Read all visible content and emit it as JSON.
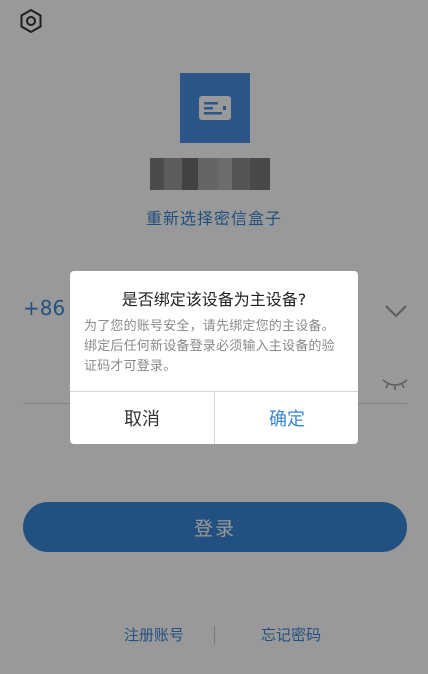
{
  "device": {
    "reselect_link": "重新选择密信盒子"
  },
  "login_form": {
    "country_code": "+86",
    "login_button": "登录",
    "register_link": "注册账号",
    "forgot_password_link": "忘记密码"
  },
  "dialog": {
    "title": "是否绑定该设备为主设备?",
    "message": "为了您的账号安全，请先绑定您的主设备。绑定后任何新设备登录必须输入主设备的验证码才可登录。",
    "cancel_label": "取消",
    "confirm_label": "确定"
  },
  "icons": {
    "settings": "gear-icon",
    "device": "box-icon",
    "dropdown": "chevron-down-icon",
    "password_visibility": "eye-closed-icon"
  },
  "colors": {
    "accent": "#3a86d6",
    "device_tile": "#4a90e2",
    "overlay": "rgba(0,0,0,0.40)"
  }
}
